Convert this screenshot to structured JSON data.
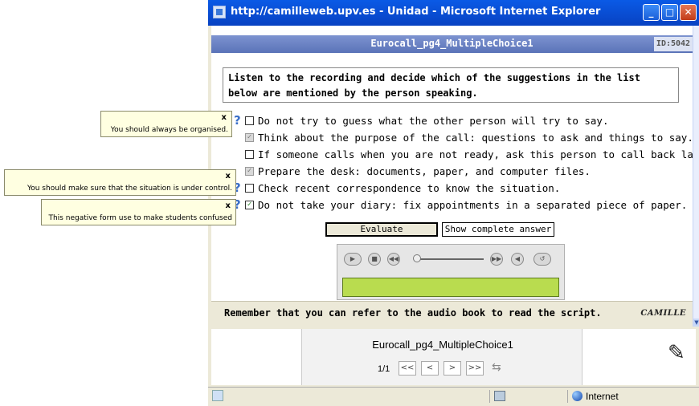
{
  "window": {
    "title": "http://camilleweb.upv.es - Unidad - Microsoft Internet Explorer",
    "min_label": "_",
    "max_label": "□",
    "close_label": "✕"
  },
  "exercise": {
    "title": "Eurocall_pg4_MultipleChoice1",
    "id_badge": "ID:5042",
    "instruction": "Listen to the recording and decide which of the suggestions in the list below are mentioned by the person speaking.",
    "help_label": "?",
    "options": [
      {
        "label": "Do not try to guess what the other person will try to say.",
        "state": "unchecked",
        "mark": ""
      },
      {
        "label": "Think about the purpose of the call: questions to ask and things to say.",
        "state": "greyed-checked",
        "mark": "✓"
      },
      {
        "label": "If someone calls when you are not ready, ask this person to call back later.",
        "state": "unchecked",
        "mark": ""
      },
      {
        "label": "Prepare the desk: documents, paper, and computer files.",
        "state": "greyed-checked",
        "mark": "✓"
      },
      {
        "label": "Check recent correspondence to know the situation.",
        "state": "unchecked",
        "mark": ""
      },
      {
        "label": "Do not take your diary: fix appointments in a separated piece of paper.",
        "state": "checked",
        "mark": "✓"
      }
    ],
    "evaluate_label": "Evaluate",
    "show_answer_label": "Show complete answer",
    "footer_text": "Remember that you can refer to the audio book to read the script.",
    "logo_text": "CAMILLE"
  },
  "player": {
    "play": "▶",
    "stop": "■",
    "rewind": "◀◀",
    "forward": "▶▶",
    "volume": "◀",
    "loop": "↺",
    "position_fraction": 0
  },
  "tooltips": [
    {
      "close": "x",
      "text": "You should always be organised."
    },
    {
      "close": "x",
      "text": "You should make sure that the situation is under control."
    },
    {
      "close": "x",
      "text": "This negative form use to make students confused"
    }
  ],
  "navigation": {
    "title": "Eurocall_pg4_MultipleChoice1",
    "page_count": "1/1",
    "first": "<<",
    "prev": "<",
    "next": ">",
    "last": ">>",
    "swap": "⇆",
    "pen": "✎"
  },
  "statusbar": {
    "zone": "Internet"
  },
  "colors": {
    "titlebar": "#0a5ae6",
    "header_bar": "#6a82c4",
    "player_display": "#b9dc4f",
    "tooltip": "#ffffe1"
  }
}
